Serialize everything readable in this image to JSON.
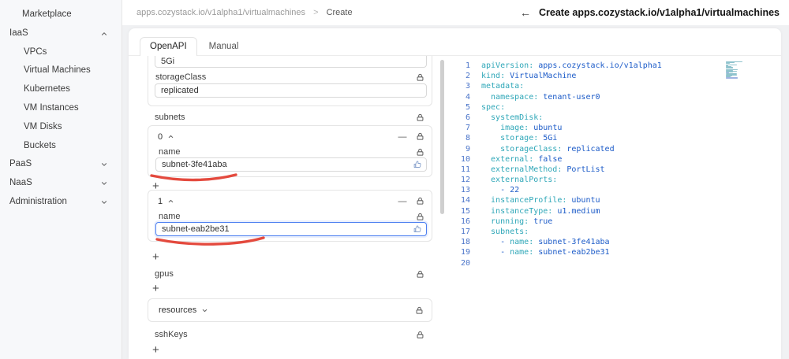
{
  "sidebar": {
    "items": [
      {
        "label": "Marketplace",
        "indent": "top"
      },
      {
        "label": "IaaS",
        "indent": "group",
        "chevron": "up"
      },
      {
        "label": "VPCs",
        "indent": "child"
      },
      {
        "label": "Virtual Machines",
        "indent": "child"
      },
      {
        "label": "Kubernetes",
        "indent": "child"
      },
      {
        "label": "VM Instances",
        "indent": "child"
      },
      {
        "label": "VM Disks",
        "indent": "child"
      },
      {
        "label": "Buckets",
        "indent": "child"
      },
      {
        "label": "PaaS",
        "indent": "group",
        "chevron": "down"
      },
      {
        "label": "NaaS",
        "indent": "group",
        "chevron": "down"
      },
      {
        "label": "Administration",
        "indent": "group",
        "chevron": "down"
      }
    ]
  },
  "header": {
    "breadcrumb_path": "apps.cozystack.io/v1alpha1/virtualmachines",
    "breadcrumb_sep": ">",
    "breadcrumb_current": "Create",
    "back_icon": "←",
    "title": "Create apps.cozystack.io/v1alpha1/virtualmachines"
  },
  "tabs": [
    {
      "label": "OpenAPI",
      "active": true
    },
    {
      "label": "Manual",
      "active": false
    }
  ],
  "form": {
    "clipped_field": {
      "value": "5Gi"
    },
    "storage_class": {
      "label": "storageClass",
      "value": "replicated"
    },
    "subnets": {
      "label": "subnets",
      "items": [
        {
          "index": "0",
          "field_label": "name",
          "value": "subnet-3fe41aba",
          "focused": false
        },
        {
          "index": "1",
          "field_label": "name",
          "value": "subnet-eab2be31",
          "focused": true
        }
      ]
    },
    "gpus": {
      "label": "gpus"
    },
    "resources": {
      "label": "resources"
    },
    "ssh_keys": {
      "label": "sshKeys"
    },
    "add_symbol": "+",
    "remove_symbol": "—"
  },
  "editor": {
    "lines": [
      [
        [
          "k",
          "apiVersion:"
        ],
        [
          "v",
          " apps.cozystack.io/v1alpha1"
        ]
      ],
      [
        [
          "k",
          "kind:"
        ],
        [
          "v",
          " VirtualMachine"
        ]
      ],
      [
        [
          "k",
          "metadata:"
        ]
      ],
      [
        [
          "k",
          "  namespace:"
        ],
        [
          "v",
          " tenant-user0"
        ]
      ],
      [
        [
          "k",
          "spec:"
        ]
      ],
      [
        [
          "k",
          "  systemDisk:"
        ]
      ],
      [
        [
          "k",
          "    image:"
        ],
        [
          "v",
          " ubuntu"
        ]
      ],
      [
        [
          "k",
          "    storage:"
        ],
        [
          "v",
          " 5Gi"
        ]
      ],
      [
        [
          "k",
          "    storageClass:"
        ],
        [
          "v",
          " replicated"
        ]
      ],
      [
        [
          "k",
          "  external:"
        ],
        [
          "v",
          " false"
        ]
      ],
      [
        [
          "k",
          "  externalMethod:"
        ],
        [
          "v",
          " PortList"
        ]
      ],
      [
        [
          "k",
          "  externalPorts:"
        ]
      ],
      [
        [
          "p",
          "    - "
        ],
        [
          "v",
          "22"
        ]
      ],
      [
        [
          "k",
          "  instanceProfile:"
        ],
        [
          "v",
          " ubuntu"
        ]
      ],
      [
        [
          "k",
          "  instanceType:"
        ],
        [
          "v",
          " u1.medium"
        ]
      ],
      [
        [
          "k",
          "  running:"
        ],
        [
          "v",
          " true"
        ]
      ],
      [
        [
          "k",
          "  subnets:"
        ]
      ],
      [
        [
          "p",
          "    - "
        ],
        [
          "k",
          "name:"
        ],
        [
          "v",
          " subnet-3fe41aba"
        ]
      ],
      [
        [
          "p",
          "    - "
        ],
        [
          "k",
          "name:"
        ],
        [
          "v",
          " subnet-eab2be31"
        ]
      ],
      []
    ]
  },
  "colors": {
    "accent_focus": "#4c7ff0",
    "yaml_key": "#2fa7b8",
    "yaml_value": "#1c5bc8",
    "line_number": "#4a74c9",
    "annotation_red": "#e23b2e"
  }
}
